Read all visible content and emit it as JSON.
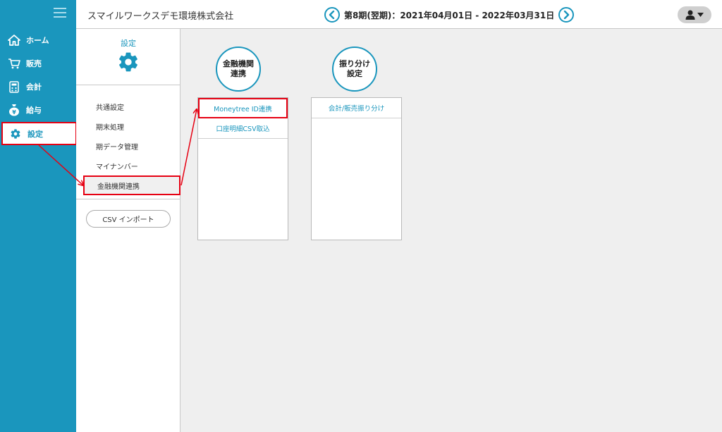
{
  "company": "スマイルワークスデモ環境株式会社",
  "period": "第8期(翌期)：2021年04月01日 - 2022年03月31日",
  "nav": {
    "items": [
      {
        "label": "ホーム",
        "icon": "home-icon"
      },
      {
        "label": "販売",
        "icon": "cart-icon"
      },
      {
        "label": "会計",
        "icon": "calculator-icon"
      },
      {
        "label": "給与",
        "icon": "money-bag-icon"
      },
      {
        "label": "設定",
        "icon": "gear-icon",
        "active": true
      }
    ]
  },
  "panel": {
    "title": "設定",
    "menu": [
      "共通設定",
      "期末処理",
      "期データ管理",
      "マイナンバー",
      "金融機関連携"
    ],
    "selected": "金融機関連携",
    "csv_import": "CSV インポート"
  },
  "categories": [
    {
      "label_line1": "金融機関",
      "label_line2": "連携",
      "items": [
        "Moneytree ID連携",
        "口座明細CSV取込"
      ]
    },
    {
      "label_line1": "振り分け",
      "label_line2": "設定",
      "items": [
        "会計/販売振り分け"
      ]
    }
  ],
  "colors": {
    "accent": "#1a96bd",
    "highlight": "#e60012",
    "background": "#efefef"
  }
}
